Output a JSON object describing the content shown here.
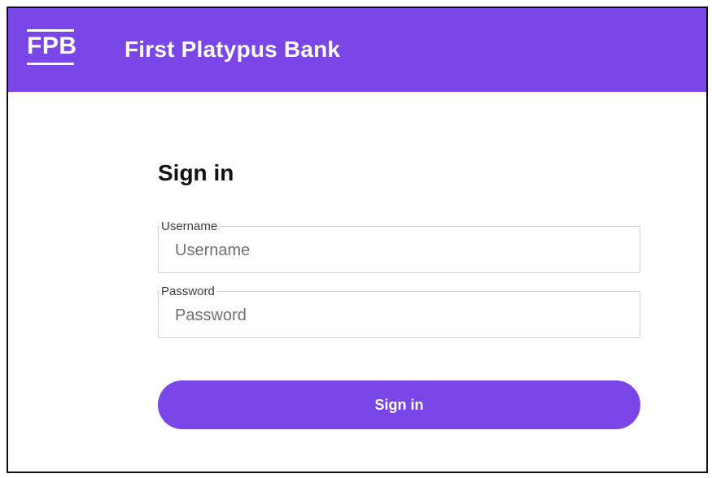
{
  "header": {
    "logo_text": "FPB",
    "bank_name": "First Platypus Bank",
    "brand_color": "#7a46e8"
  },
  "signin": {
    "title": "Sign in",
    "username": {
      "label": "Username",
      "placeholder": "Username",
      "value": ""
    },
    "password": {
      "label": "Password",
      "placeholder": "Password",
      "value": ""
    },
    "submit_label": "Sign in"
  }
}
